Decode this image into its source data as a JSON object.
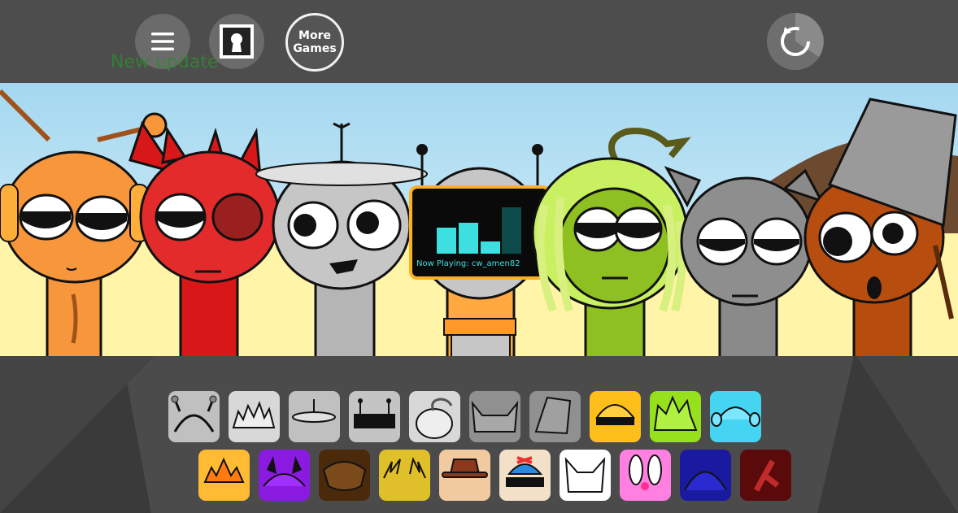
{
  "toolbar": {
    "menu_icon": "hamburger-menu-icon",
    "profile_icon": "keyhole-profile-icon",
    "more_games_line1": "More",
    "more_games_line2": "Games",
    "reset_icon": "restart-icon",
    "new_update_label": "New update"
  },
  "now_playing": {
    "label": "Now Playing: cw_amen82"
  },
  "characters": [
    {
      "name": "orange-headphones",
      "color": "#f7963b"
    },
    {
      "name": "red-devil",
      "color": "#e02020"
    },
    {
      "name": "grey-saucer",
      "color": "#b9b9b9"
    },
    {
      "name": "tv-robot",
      "color": "#ffa940"
    },
    {
      "name": "green-dreads",
      "color": "#8dc020"
    },
    {
      "name": "grey-cat",
      "color": "#8a8a8a"
    },
    {
      "name": "brown-bucket",
      "color": "#b64c0e"
    }
  ],
  "tray": {
    "row1": [
      {
        "icon": "antenna-headphones-icon",
        "bg": "#c0c0c0"
      },
      {
        "icon": "spiky-hair-icon",
        "bg": "#d8d8d8"
      },
      {
        "icon": "saucer-hat-icon",
        "bg": "#c0c0c0"
      },
      {
        "icon": "tv-screen-icon",
        "bg": "#c4c4c4"
      },
      {
        "icon": "sprout-head-icon",
        "bg": "#d8d8d8"
      },
      {
        "icon": "cat-ears-icon",
        "bg": "#909090"
      },
      {
        "icon": "bucket-hat-icon",
        "bg": "#909090"
      },
      {
        "icon": "yellow-visor-icon",
        "bg": "#ffbf1a"
      },
      {
        "icon": "green-spiky-hair-icon",
        "bg": "#96e01c"
      },
      {
        "icon": "blue-headphones-icon",
        "bg": "#45d4f2"
      }
    ],
    "row2": [
      {
        "icon": "crown-burst-icon",
        "bg": "#ffbb33"
      },
      {
        "icon": "purple-horns-icon",
        "bg": "#8a1ae0"
      },
      {
        "icon": "brown-wig-icon",
        "bg": "#4a2a0a"
      },
      {
        "icon": "lightning-hair-icon",
        "bg": "#e0c02a"
      },
      {
        "icon": "brown-fedora-icon",
        "bg": "#f2caa0"
      },
      {
        "icon": "propeller-cap-icon",
        "bg": "#f2e0c8"
      },
      {
        "icon": "white-cat-ears-icon",
        "bg": "#ffffff"
      },
      {
        "icon": "bunny-ears-icon",
        "bg": "#ff80e0"
      },
      {
        "icon": "dark-dome-icon",
        "bg": "#1a1aa0"
      },
      {
        "icon": "red-splat-icon",
        "bg": "#5a0a0a"
      }
    ]
  }
}
